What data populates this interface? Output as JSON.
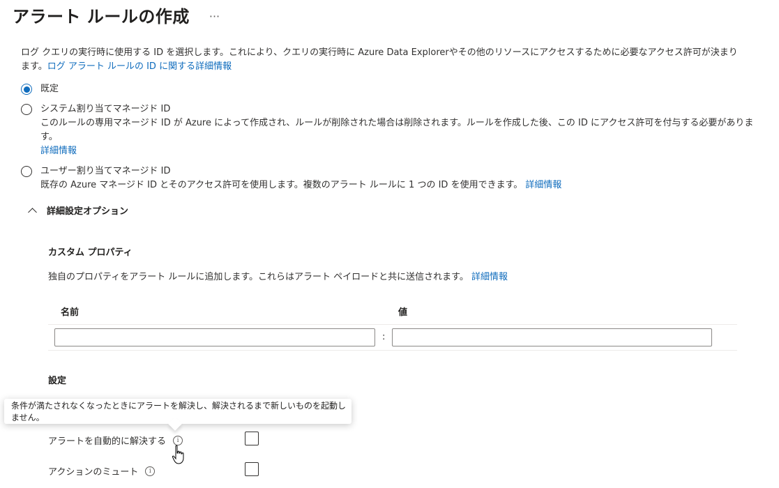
{
  "header": {
    "title": "アラート ルールの作成",
    "more_label": "···"
  },
  "identity": {
    "description": "ログ クエリの実行時に使用する ID を選択します。これにより、クエリの実行時に Azure Data Explorerやその他のリソースにアクセスするために必要なアクセス許可が決まります。",
    "description_link": "ログ アラート ルールの ID に関する詳細情報",
    "options": [
      {
        "label": "既定",
        "selected": true
      },
      {
        "label": "システム割り当てマネージド ID",
        "selected": false,
        "description": "このルールの専用マネージド ID が Azure によって作成され、ルールが削除された場合は削除されます。ルールを作成した後、この ID にアクセス許可を付与する必要があります。",
        "link": "詳細情報"
      },
      {
        "label": "ユーザー割り当てマネージド ID",
        "selected": false,
        "description": "既存の Azure マネージド ID とそのアクセス許可を使用します。複数のアラート ルールに 1 つの ID を使用できます。",
        "link": "詳細情報"
      }
    ]
  },
  "advanced": {
    "header": "詳細設定オプション",
    "custom_properties": {
      "title": "カスタム プロパティ",
      "description": "独自のプロパティをアラート ルールに追加します。これらはアラート ペイロードと共に送信されます。",
      "link": "詳細情報",
      "name_header": "名前",
      "value_header": "値",
      "separator": ":",
      "name_value": "",
      "value_value": ""
    },
    "settings": {
      "title": "設定",
      "tooltip": "条件が満たされなくなったときにアラートを解決し、解決されるまで新しいものを起動しません。",
      "auto_resolve_label": "アラートを自動的に解決する",
      "auto_resolve_checked": false,
      "mute_actions_label": "アクションのミュート",
      "mute_actions_checked": false,
      "info_glyph": "i"
    }
  },
  "colors": {
    "accent": "#0f6cbd",
    "text": "#323130"
  }
}
